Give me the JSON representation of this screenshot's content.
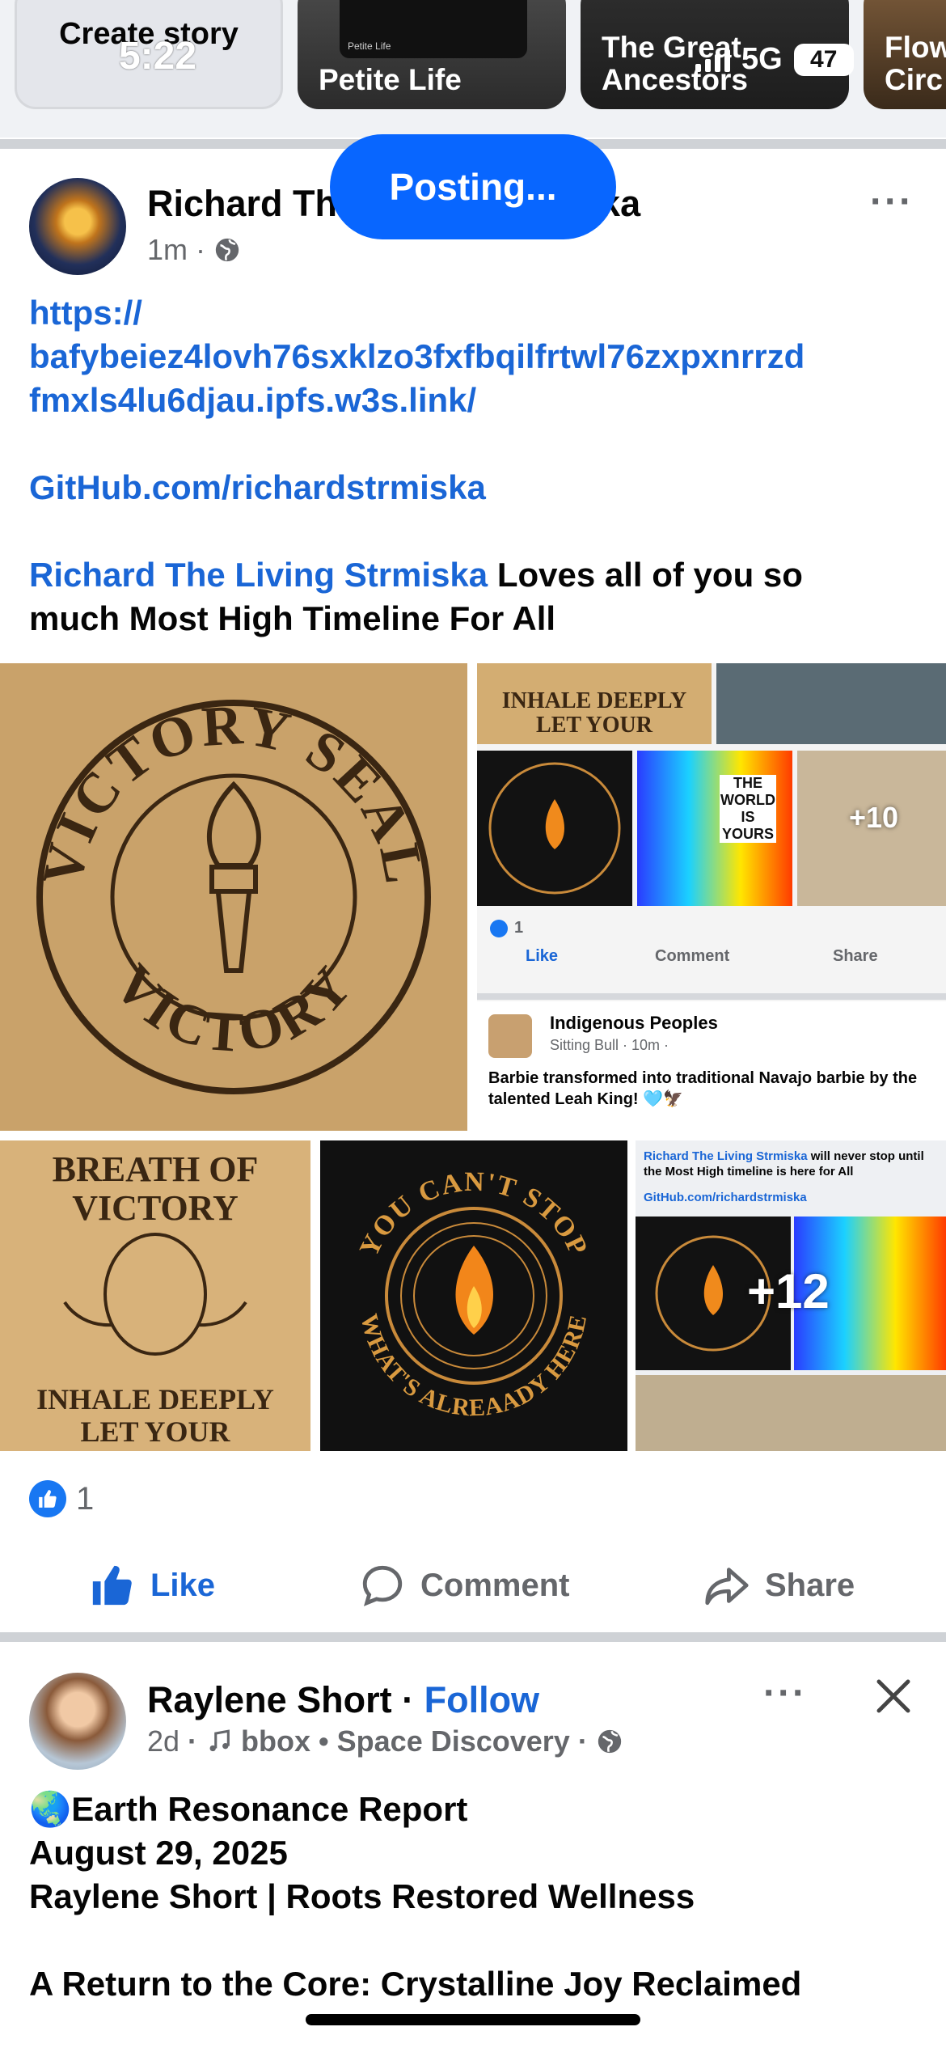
{
  "status_bar": {
    "time": "5:22",
    "network": "5G",
    "battery": "47"
  },
  "stories": [
    {
      "title": "Create story"
    },
    {
      "title": "Petite Life",
      "mini_text": "Petite Life"
    },
    {
      "title": "The Great Ancestors"
    },
    {
      "title": "Flow Circ"
    }
  ],
  "posting_banner": "Posting...",
  "post1": {
    "author": "Richard The Living Strmiska",
    "author_visible_start": "Richard Th",
    "author_visible_end": "ska",
    "time": "1m",
    "privacy_icon": "globe-icon",
    "lines": [
      {
        "text": "https://",
        "link": true
      },
      {
        "text": "bafybeiez4lovh76sxklzo3fxfbqilfrtwl76zxpxnrrzd",
        "link": true
      },
      {
        "text": "fmxls4lu6djau.ipfs.w3s.link/",
        "link": true
      }
    ],
    "github": "GitHub.com/richardstrmiska",
    "tag_name": "Richard The Living Strmiska",
    "message_a": " Loves all of you so",
    "message_b": "much Most High Timeline For All",
    "images": {
      "victory_seal_top": "VICTORY SEAL",
      "victory_seal_bottom": "VICTORY",
      "breath_title_1": "BREATH OF",
      "breath_title_2": "VICTORY",
      "breath_bottom_1": "INHALE DEEPLY",
      "breath_bottom_2": "LET YOUR",
      "cant_stop_top": "YOU CAN'T STOP",
      "cant_stop_bottom": "WHAT'S ALREAADY HERE",
      "world_yours": "THE WORLD IS YOURS",
      "plus_more_small": "+10",
      "plus_more": "+12",
      "mini_reaction_count": "1",
      "mini_like": "Like",
      "mini_comment": "Comment",
      "mini_share": "Share",
      "mini_group": "Indigenous Peoples",
      "mini_group_meta": "Sitting Bull · 10m ·",
      "mini_group_text": "Barbie transformed into traditional Navajo barbie by the talented Leah King! 🩵🦅",
      "g5_caption_name": "Richard The Living Strmiska",
      "g5_caption_rest": " will never stop until the Most High timeline is here for All",
      "g5_caption_link": "GitHub.com/richardstrmiska"
    },
    "reaction_count": "1",
    "actions": {
      "like": "Like",
      "comment": "Comment",
      "share": "Share"
    }
  },
  "post2": {
    "author": "Raylene Short",
    "follow": "Follow",
    "time": "2d",
    "music": "bbox • Space Discovery",
    "lines": [
      "🌏Earth Resonance Report",
      "August 29, 2025",
      "Raylene Short | Roots Restored Wellness",
      "",
      "A Return to the Core: Crystalline Joy Reclaimed"
    ]
  },
  "colors": {
    "accent": "#0866ff",
    "link": "#1a66d6",
    "muted": "#65676b",
    "divider": "#cfd2d6"
  }
}
